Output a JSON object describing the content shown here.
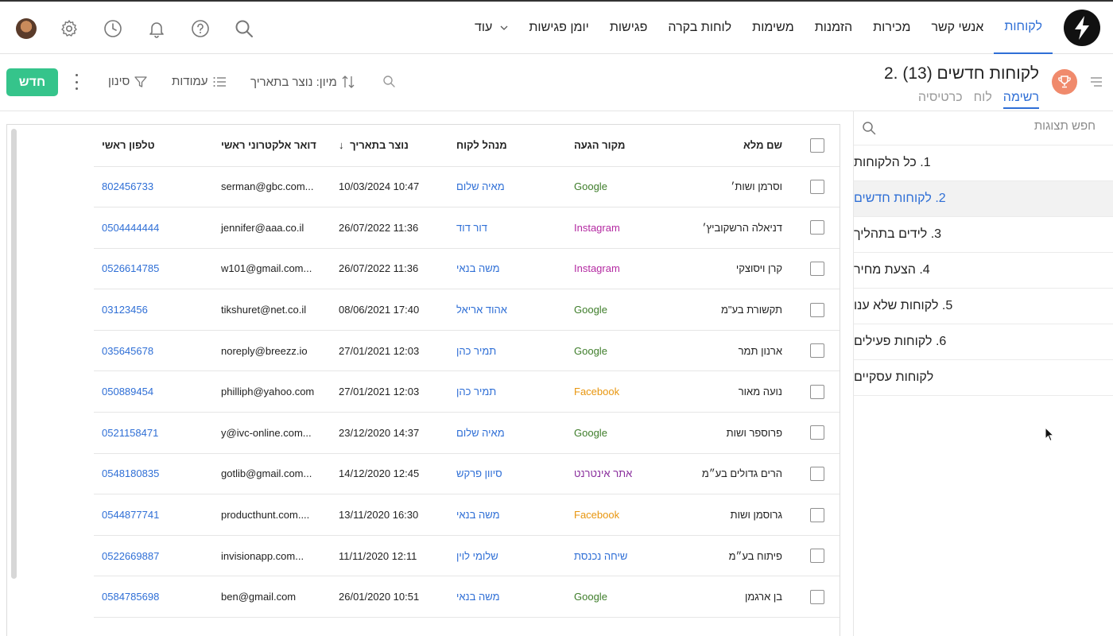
{
  "nav": {
    "items": [
      "לקוחות",
      "אנשי קשר",
      "מכירות",
      "הזמנות",
      "משימות",
      "לוחות בקרה",
      "פגישות",
      "יומן פגישות"
    ],
    "more_label": "עוד",
    "active_index": 0
  },
  "view": {
    "title": "2. לקוחות חדשים (13)",
    "tabs": [
      "רשימה",
      "לוח",
      "כרטיסיה"
    ],
    "active_tab": 0,
    "sort_label": "מיון: נוצר בתאריך",
    "columns_label": "עמודות",
    "filter_label": "סינון",
    "new_button": "חדש"
  },
  "sidebar": {
    "search_placeholder": "חפש תצוגות",
    "items": [
      "1. כל הלקוחות",
      "2. לקוחות חדשים",
      "3. לידים בתהליך",
      "4. הצעת מחיר",
      "5. לקוחות שלא ענו",
      "6. לקוחות פעילים",
      "לקוחות עסקיים"
    ],
    "active_index": 1
  },
  "table": {
    "headers": {
      "name": "שם מלא",
      "source": "מקור הגעה",
      "manager": "מנהל לקוח",
      "created": "נוצר בתאריך",
      "email": "דואר אלקטרוני ראשי",
      "phone": "טלפון ראשי",
      "sort_arrow": "↓"
    },
    "rows": [
      {
        "name": "וסרמן ושות׳",
        "source": "Google",
        "source_type": "google",
        "manager": "מאיה שלום",
        "created": "10/03/2024 10:47",
        "email": "serman@gbc.com...",
        "phone": "802456733"
      },
      {
        "name": "דניאלה הרשקוביץ׳",
        "source": "Instagram",
        "source_type": "instagram",
        "manager": "דור דוד",
        "created": "26/07/2022 11:36",
        "email": "jennifer@aaa.co.il",
        "phone": "0504444444"
      },
      {
        "name": "קרן ויסוצקי",
        "source": "Instagram",
        "source_type": "instagram",
        "manager": "משה בנאי",
        "created": "26/07/2022 11:36",
        "email": "w101@gmail.com...",
        "phone": "0526614785"
      },
      {
        "name": "תקשורת בע\"מ",
        "source": "Google",
        "source_type": "google",
        "manager": "אהוד אריאל",
        "created": "08/06/2021 17:40",
        "email": "tikshuret@net.co.il",
        "phone": "03123456"
      },
      {
        "name": "ארנון תמר",
        "source": "Google",
        "source_type": "google",
        "manager": "תמיר כהן",
        "created": "27/01/2021 12:03",
        "email": "noreply@breezz.io",
        "phone": "035645678"
      },
      {
        "name": "נועה מאור",
        "source": "Facebook",
        "source_type": "facebook",
        "manager": "תמיר כהן",
        "created": "27/01/2021 12:03",
        "email": "philliph@yahoo.com",
        "phone": "050889454"
      },
      {
        "name": "פרוספר ושות",
        "source": "Google",
        "source_type": "google",
        "manager": "מאיה שלום",
        "created": "23/12/2020 14:37",
        "email": "y@ivc-online.com...",
        "phone": "0521158471"
      },
      {
        "name": "הרים גדולים בע״מ",
        "source": "אתר אינטרנט",
        "source_type": "web",
        "manager": "סיוון פרקש",
        "created": "14/12/2020 12:45",
        "email": "gotlib@gmail.com...",
        "phone": "0548180835"
      },
      {
        "name": "גרוסמן ושות",
        "source": "Facebook",
        "source_type": "facebook",
        "manager": "משה בנאי",
        "created": "13/11/2020 16:30",
        "email": "producthunt.com....",
        "phone": "0544877741"
      },
      {
        "name": "פיתוח בע״מ",
        "source": "שיחה נכנסת",
        "source_type": "phone",
        "manager": "שלומי לוין",
        "created": "11/11/2020 12:11",
        "email": "invisionapp.com...",
        "phone": "0522669887"
      },
      {
        "name": "בן ארגמן",
        "source": "Google",
        "source_type": "google",
        "manager": "משה בנאי",
        "created": "26/01/2020 10:51",
        "email": "ben@gmail.com",
        "phone": "0584785698"
      }
    ]
  },
  "colors": {
    "accent": "#2f6fd6",
    "new_button": "#35c48b",
    "trophy": "#f08a6c",
    "google": "#3e7d2a",
    "instagram": "#b42aa2",
    "facebook": "#e8960f"
  }
}
